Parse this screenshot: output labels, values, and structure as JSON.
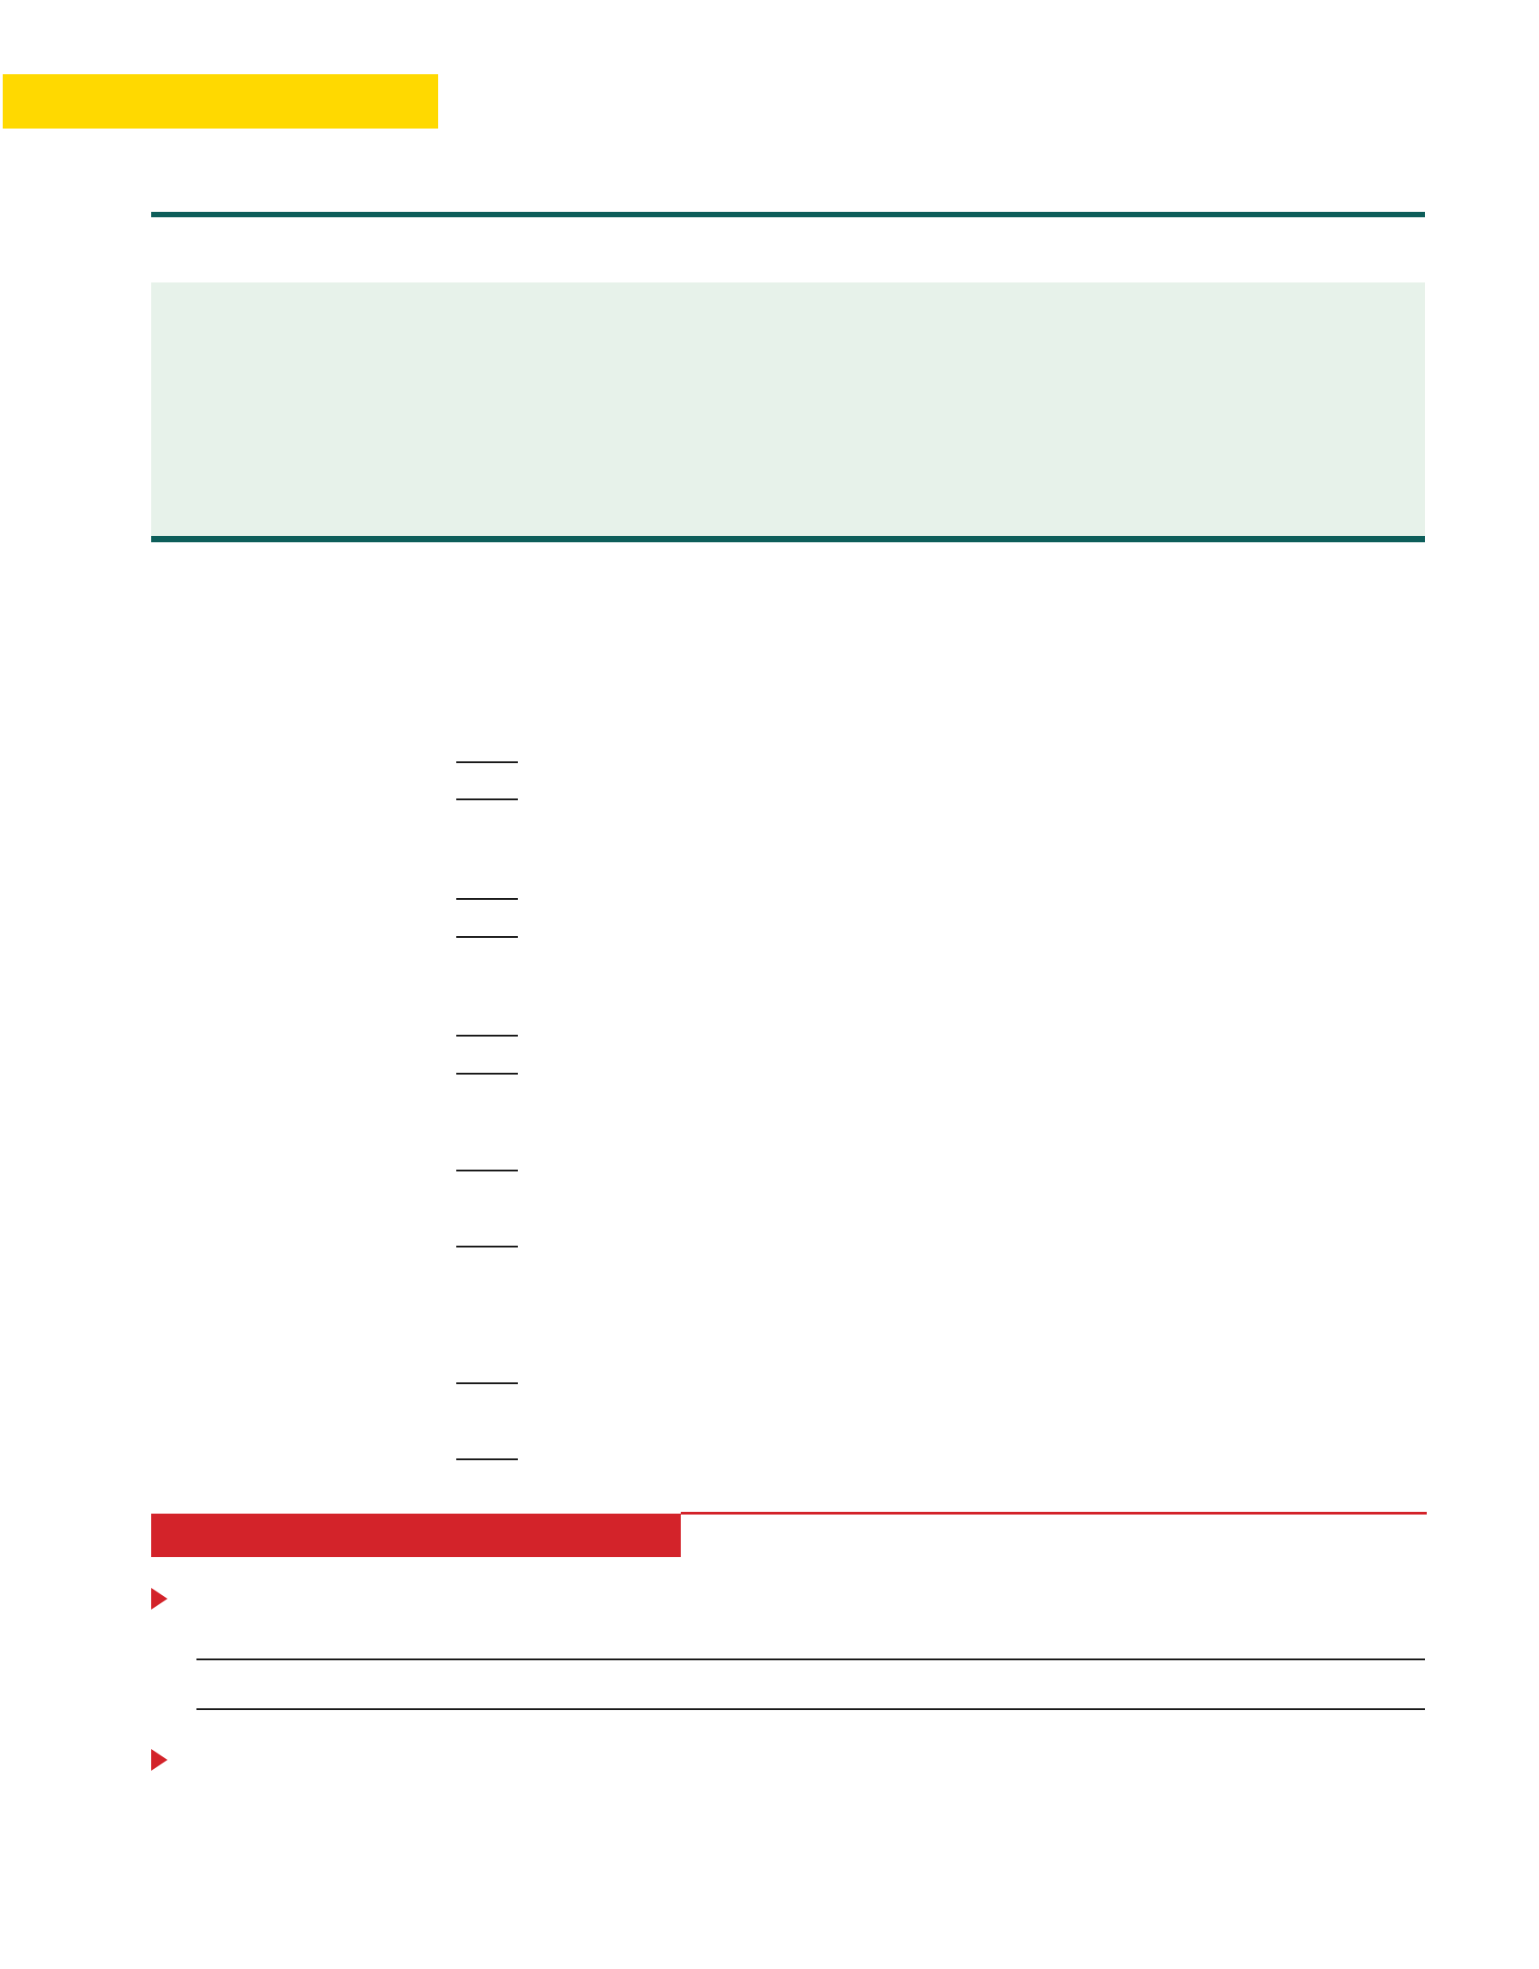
{
  "colors": {
    "highlight_tab": "#ffd900",
    "rule_teal": "#0d5e5a",
    "panel_mint": "#e7f2ea",
    "accent_red": "#d3232a",
    "ink": "#1b1b1b"
  },
  "icons": {
    "bullet": "red-triangle-bullet-icon"
  }
}
